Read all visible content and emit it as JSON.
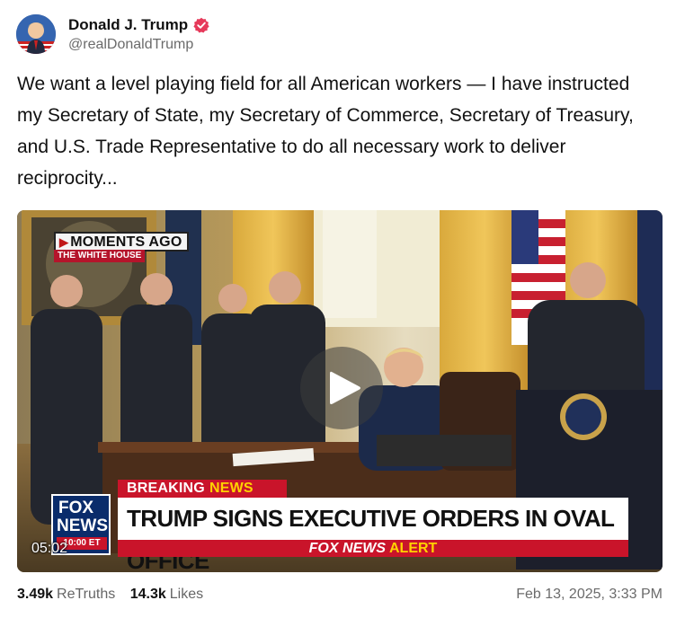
{
  "author": {
    "display_name": "Donald J. Trump",
    "handle": "@realDonaldTrump",
    "verified_icon": "verified-badge-icon",
    "avatar_icon": "avatar"
  },
  "post": {
    "text": "We want a level playing field for all American workers — I have instructed my Secretary of State, my Secretary of Commerce, Secretary of Treasury, and U.S. Trade Representative to do all necessary work to deliver reciprocity..."
  },
  "video": {
    "timestamp": "05:02",
    "moments_tag": "MOMENTS AGO",
    "location_tag": "THE WHITE HOUSE",
    "breaking_label": "BREAKING",
    "breaking_news": "NEWS",
    "headline": "TRUMP SIGNS EXECUTIVE ORDERS IN OVAL OFFICE",
    "alert_prefix": "FOX NEWS",
    "alert_word": "ALERT",
    "logo_line1": "FOX",
    "logo_line2": "NEWS",
    "logo_line3": "10:00 ET",
    "play_icon": "play-icon"
  },
  "stats": {
    "retruths_count": "3.49k",
    "retruths_label": "ReTruths",
    "likes_count": "14.3k",
    "likes_label": "Likes",
    "date": "Feb 13, 2025, 3:33 PM"
  },
  "colors": {
    "fox_red": "#c9142a",
    "fox_blue": "#0a2c6b",
    "fox_yellow": "#ffd200",
    "verified": "#e6395a"
  }
}
